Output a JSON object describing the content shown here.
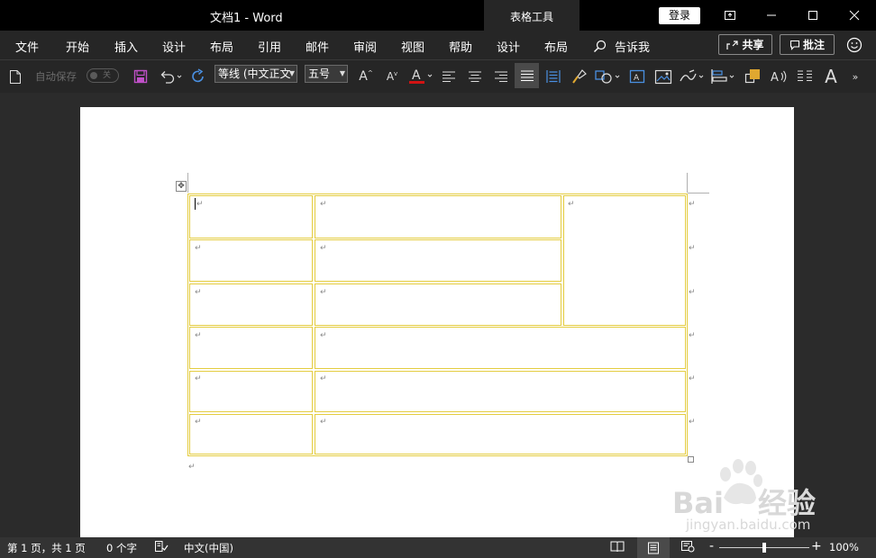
{
  "titlebar": {
    "document_title": "文档1  -  Word",
    "context_tab": "表格工具",
    "login_label": "登录"
  },
  "menu": {
    "items": [
      "文件",
      "开始",
      "插入",
      "设计",
      "布局",
      "引用",
      "邮件",
      "审阅",
      "视图",
      "帮助",
      "设计",
      "布局"
    ],
    "tell_me": "告诉我",
    "share_label": "共享",
    "comment_label": "批注"
  },
  "toolbar": {
    "autosave_label": "自动保存",
    "autosave_state": "关",
    "font_name": "等线 (中文正文",
    "font_size": "五号",
    "font_color": "#d11313",
    "icons": [
      "new-doc-icon",
      "save-icon",
      "undo-icon",
      "redo-icon",
      "grow-font-icon",
      "shrink-font-icon",
      "font-color-icon",
      "align-left-icon",
      "align-center-icon",
      "align-right-icon",
      "justify-icon",
      "distributed-icon",
      "format-painter-icon",
      "shapes-icon",
      "textbox-icon",
      "picture-icon",
      "draw-icon",
      "align-objects-icon",
      "bring-forward-icon",
      "read-aloud-icon",
      "columns-icon",
      "font-size-icon",
      "more-icon"
    ]
  },
  "document": {
    "paragraph_mark": "↵",
    "table": {
      "rows": 6,
      "border_color": "#e4cc3f"
    }
  },
  "status": {
    "page": "第 1 页，共 1 页",
    "words": "0 个字",
    "language": "中文(中国)",
    "zoom": "100%",
    "zoom_minus": "-",
    "zoom_plus": "+"
  },
  "watermark": {
    "brand": "Bai",
    "brand_tail": "经验",
    "url": "jingyan.baidu.com"
  }
}
